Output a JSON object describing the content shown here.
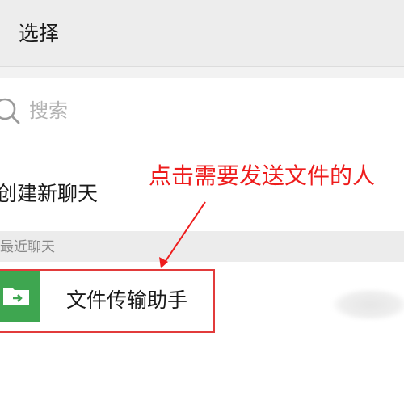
{
  "header": {
    "title": "选择"
  },
  "search": {
    "placeholder": "搜索"
  },
  "new_chat": {
    "label": "创建新聊天"
  },
  "annotation": {
    "text": "点击需要发送文件的人"
  },
  "recent_section": {
    "label": "最近聊天"
  },
  "chats": [
    {
      "name": "文件传输助手",
      "avatar_icon": "folder-share-icon",
      "avatar_color": "#3ea650"
    }
  ],
  "colors": {
    "header_bg": "#ededed",
    "annotation": "#ee1c1c",
    "highlight_border": "#e23b3b",
    "avatar_green": "#3ea650"
  }
}
